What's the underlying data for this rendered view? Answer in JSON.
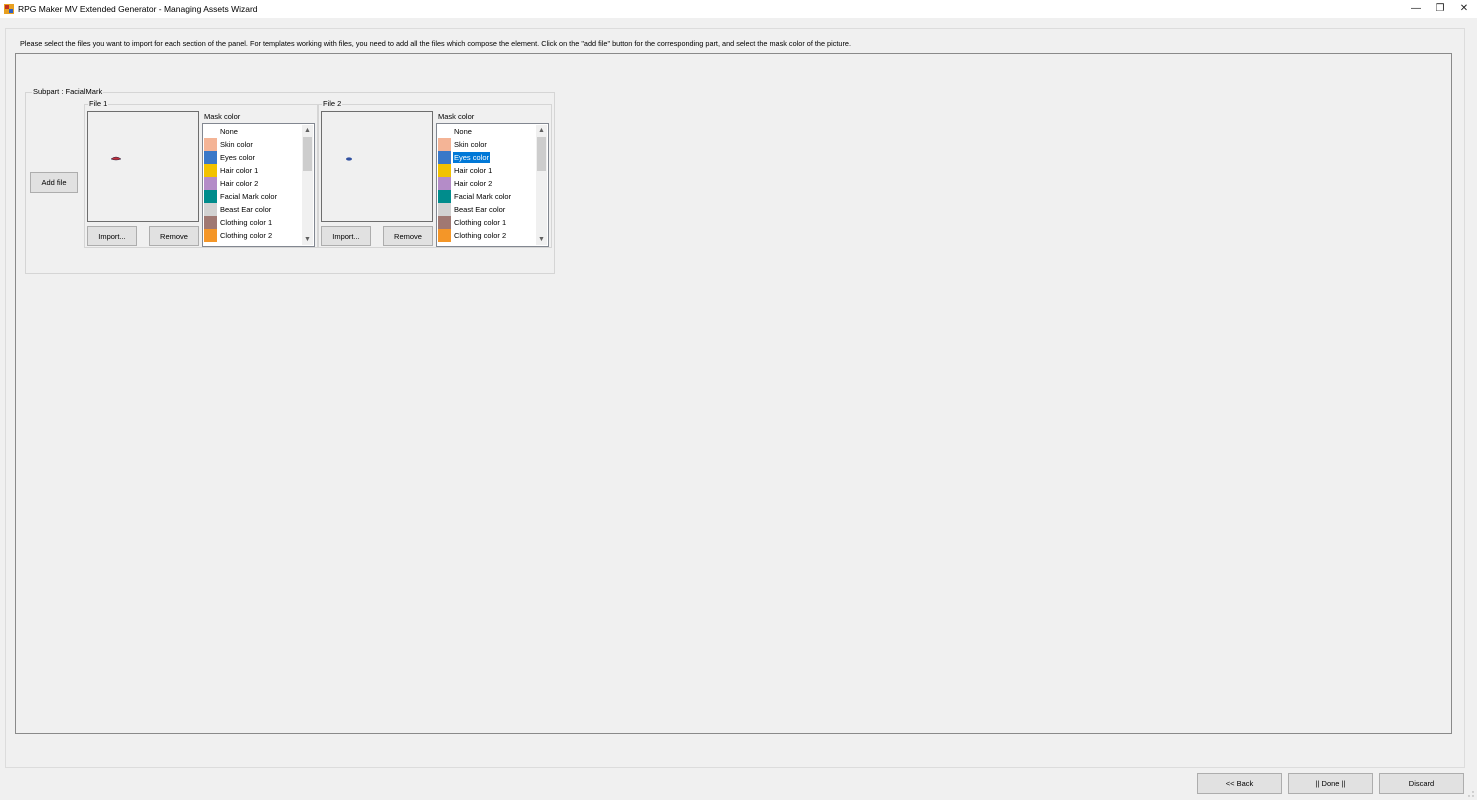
{
  "window": {
    "title": "RPG Maker MV Extended Generator - Managing Assets Wizard",
    "minimize_glyph": "—",
    "restore_glyph": "❐",
    "close_glyph": "✕"
  },
  "instructions": "Please select the files you want to import for each section of the panel. For templates working with files, you need to add all the files which compose the element. Click on the \"add file\" button for the corresponding part, and select the mask color of the picture.",
  "subpart": {
    "title": "Subpart : FacialMark",
    "add_file_label": "Add file",
    "files": [
      {
        "title": "File 1",
        "import_label": "Import...",
        "remove_label": "Remove",
        "mask_label": "Mask color",
        "selected_index": -1,
        "preview_color": "#c0303a"
      },
      {
        "title": "File 2",
        "import_label": "Import...",
        "remove_label": "Remove",
        "mask_label": "Mask color",
        "selected_index": 2,
        "preview_color": "#3050a0"
      }
    ]
  },
  "mask_colors": [
    {
      "label": "None",
      "color": "#ffffff"
    },
    {
      "label": "Skin color",
      "color": "#f4b496"
    },
    {
      "label": "Eyes color",
      "color": "#3a78c8"
    },
    {
      "label": "Hair color 1",
      "color": "#f2c200"
    },
    {
      "label": "Hair color 2",
      "color": "#b48cc8"
    },
    {
      "label": "Facial Mark color",
      "color": "#008c8c"
    },
    {
      "label": "Beast Ear color",
      "color": "#d2d2d2"
    },
    {
      "label": "Clothing color 1",
      "color": "#a07872"
    },
    {
      "label": "Clothing color 2",
      "color": "#f49628"
    }
  ],
  "footer": {
    "back_label": "<< Back",
    "done_label": "|| Done ||",
    "discard_label": "Discard"
  }
}
